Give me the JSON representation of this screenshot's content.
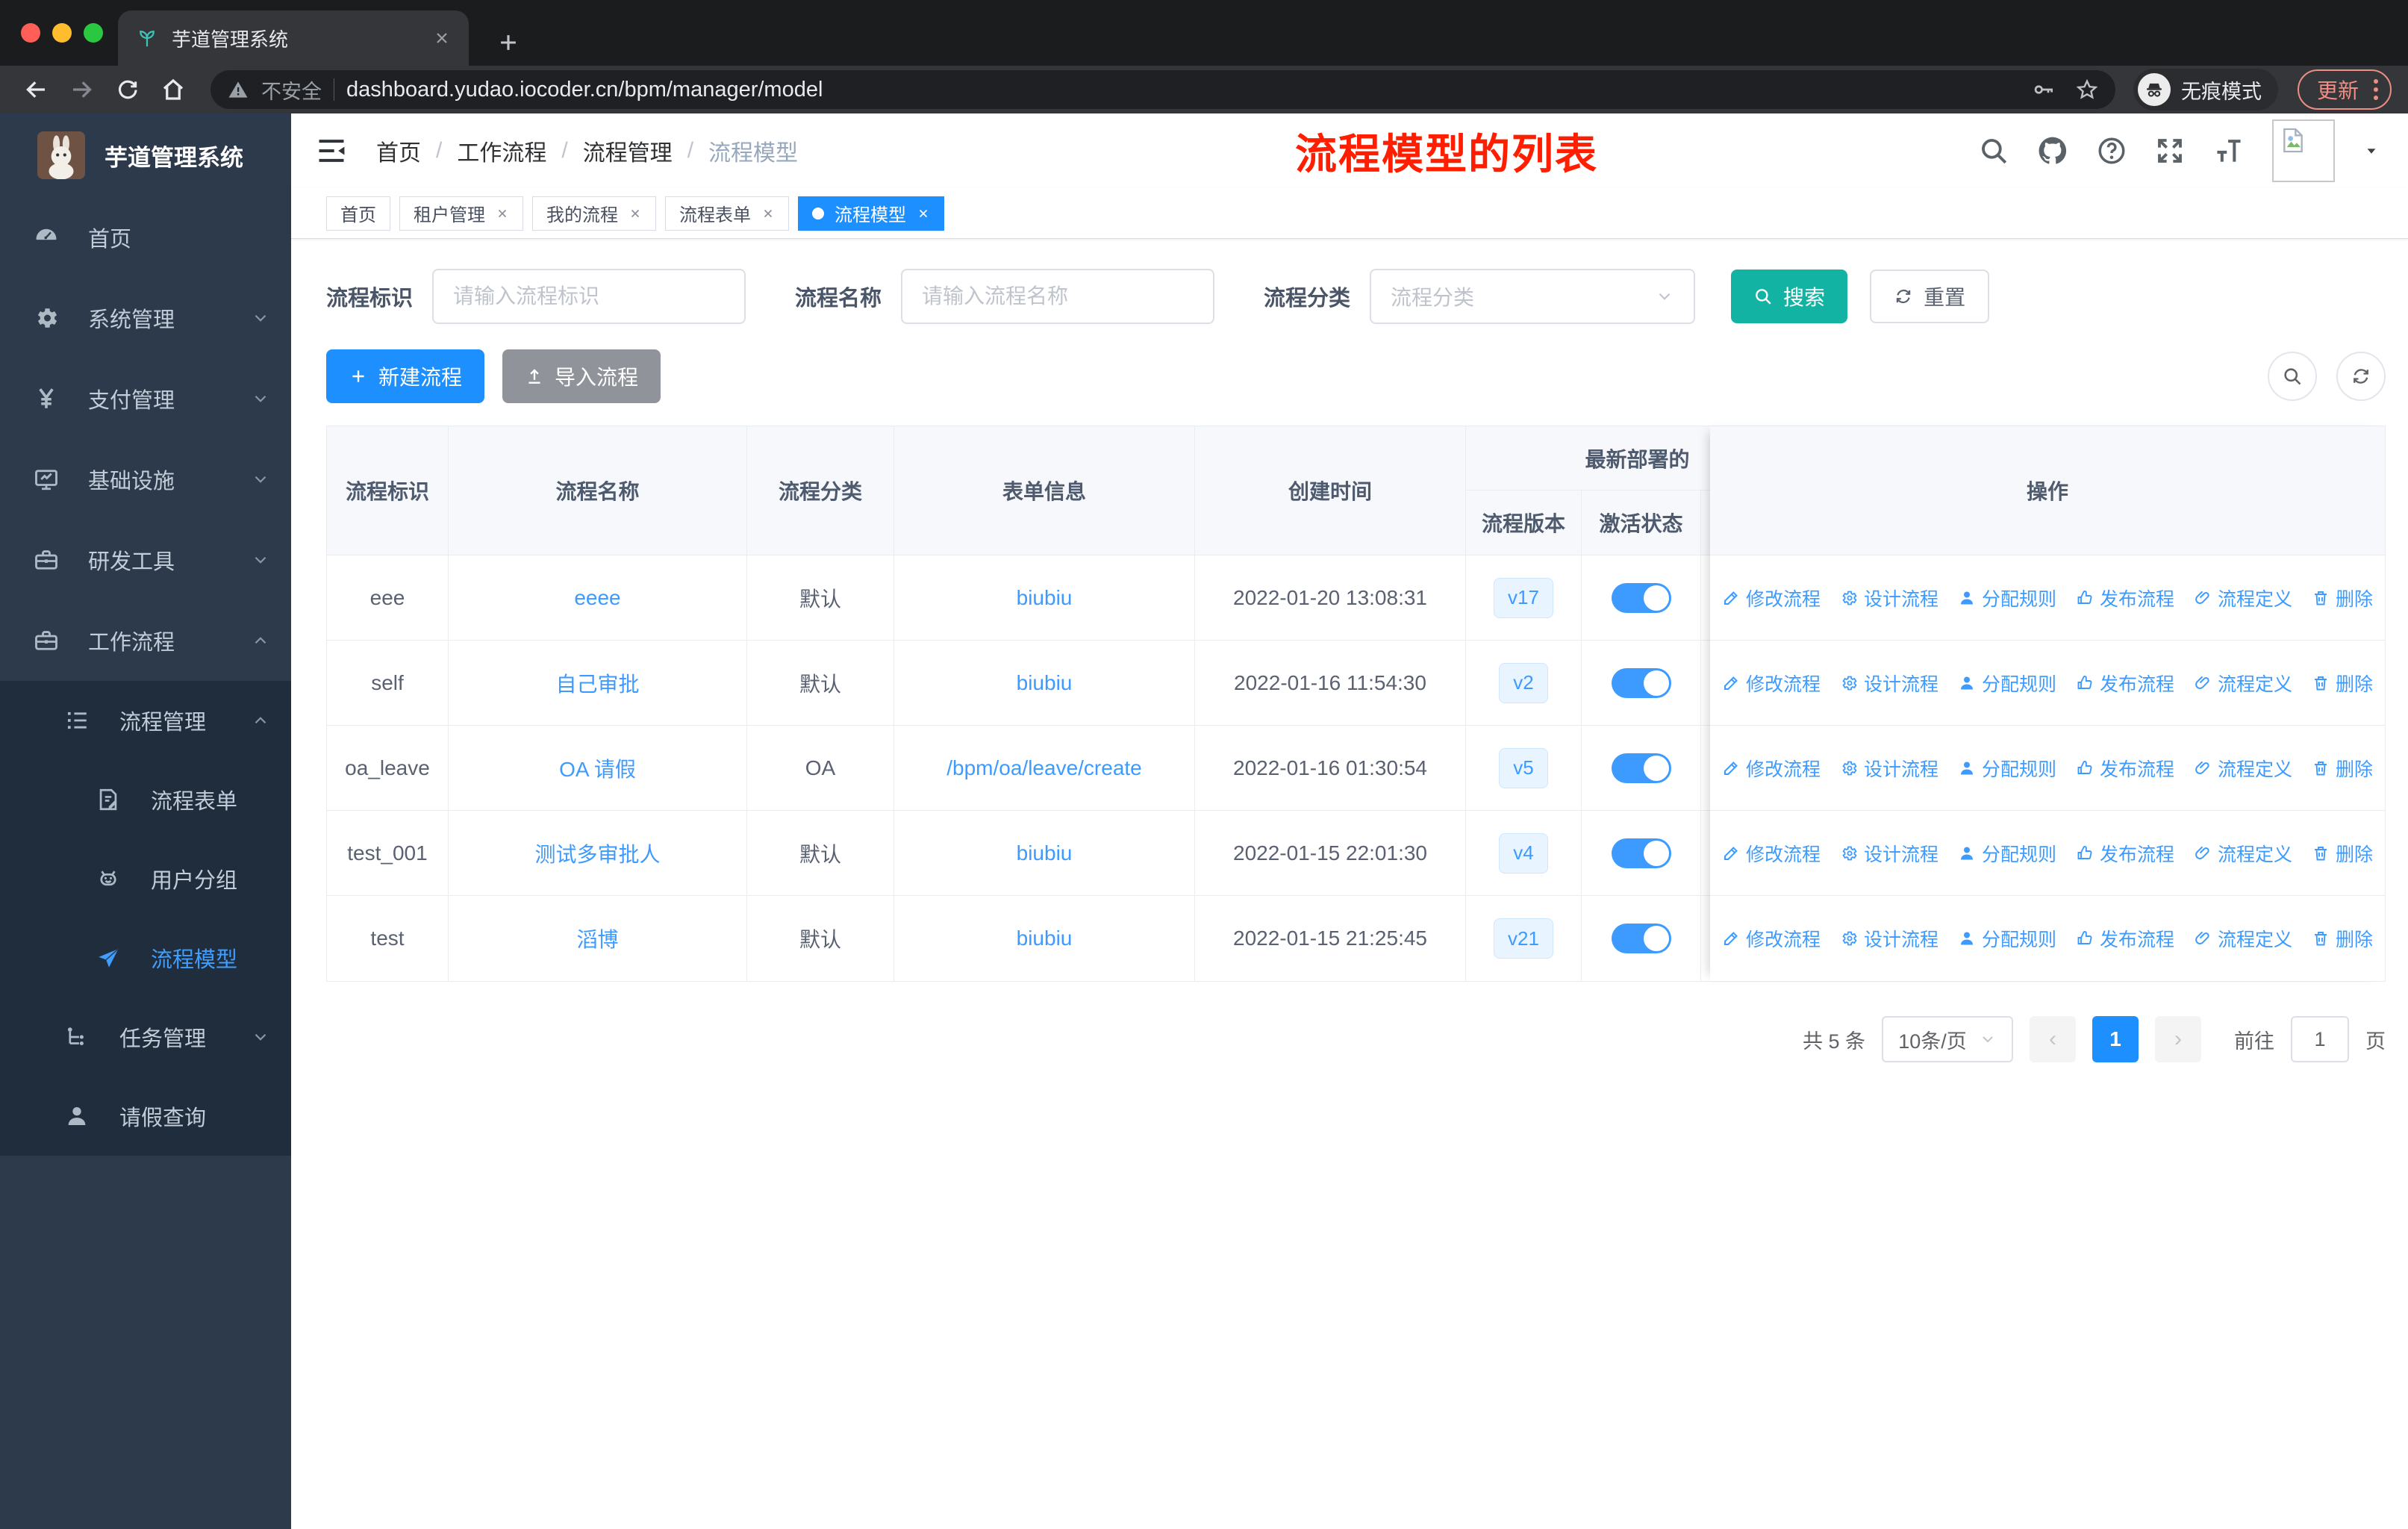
{
  "browser": {
    "tab_title": "芋道管理系统",
    "security_label": "不安全",
    "url": "dashboard.yudao.iocoder.cn/bpm/manager/model",
    "incognito_label": "无痕模式",
    "update_label": "更新"
  },
  "sidebar": {
    "app_title": "芋道管理系统",
    "items": [
      "首页",
      "系统管理",
      "支付管理",
      "基础设施",
      "研发工具",
      "工作流程"
    ],
    "submenu_items": [
      "流程管理",
      "流程表单",
      "用户分组",
      "流程模型",
      "任务管理",
      "请假查询"
    ]
  },
  "header": {
    "breadcrumb": [
      "首页",
      "工作流程",
      "流程管理",
      "流程模型"
    ],
    "annotation": "流程模型的列表"
  },
  "tags": [
    "首页",
    "租户管理",
    "我的流程",
    "流程表单",
    "流程模型"
  ],
  "filters": {
    "key_label": "流程标识",
    "key_placeholder": "请输入流程标识",
    "name_label": "流程名称",
    "name_placeholder": "请输入流程名称",
    "category_label": "流程分类",
    "category_placeholder": "流程分类",
    "search_label": "搜索",
    "reset_label": "重置"
  },
  "toolbar": {
    "create_label": "新建流程",
    "import_label": "导入流程"
  },
  "table": {
    "columns": [
      "流程标识",
      "流程名称",
      "流程分类",
      "表单信息",
      "创建时间"
    ],
    "group_header": "最新部署的",
    "sub_columns": [
      "流程版本",
      "激活状态"
    ],
    "actions_header": "操作",
    "actions": [
      "修改流程",
      "设计流程",
      "分配规则",
      "发布流程",
      "流程定义",
      "删除"
    ],
    "rows": [
      {
        "id": "eee",
        "name": "eeee",
        "category": "默认",
        "form": "biubiu",
        "created": "2022-01-20 13:08:31",
        "version": "v17",
        "active": true
      },
      {
        "id": "self",
        "name": "自己审批",
        "category": "默认",
        "form": "biubiu",
        "created": "2022-01-16 11:54:30",
        "version": "v2",
        "active": true
      },
      {
        "id": "oa_leave",
        "name": "OA 请假",
        "category": "OA",
        "form": "/bpm/oa/leave/create",
        "created": "2022-01-16 01:30:54",
        "version": "v5",
        "active": true
      },
      {
        "id": "test_001",
        "name": "测试多审批人",
        "category": "默认",
        "form": "biubiu",
        "created": "2022-01-15 22:01:30",
        "version": "v4",
        "active": true
      },
      {
        "id": "test",
        "name": "滔博",
        "category": "默认",
        "form": "biubiu",
        "created": "2022-01-15 21:25:45",
        "version": "v21",
        "active": true
      }
    ]
  },
  "pagination": {
    "total": "共 5 条",
    "page_size": "10条/页",
    "prev": "‹",
    "page": "1",
    "next": "›",
    "goto_label": "前往",
    "goto_value": "1",
    "unit_label": "页"
  },
  "colors": {
    "primary": "#1e8ffe",
    "link": "#3d9bff",
    "search_teal": "#12b3a2",
    "sidebar_bg": "#2d3a4b",
    "submenu_bg": "#1f2d3d",
    "annotation_red": "#ff1e00"
  }
}
